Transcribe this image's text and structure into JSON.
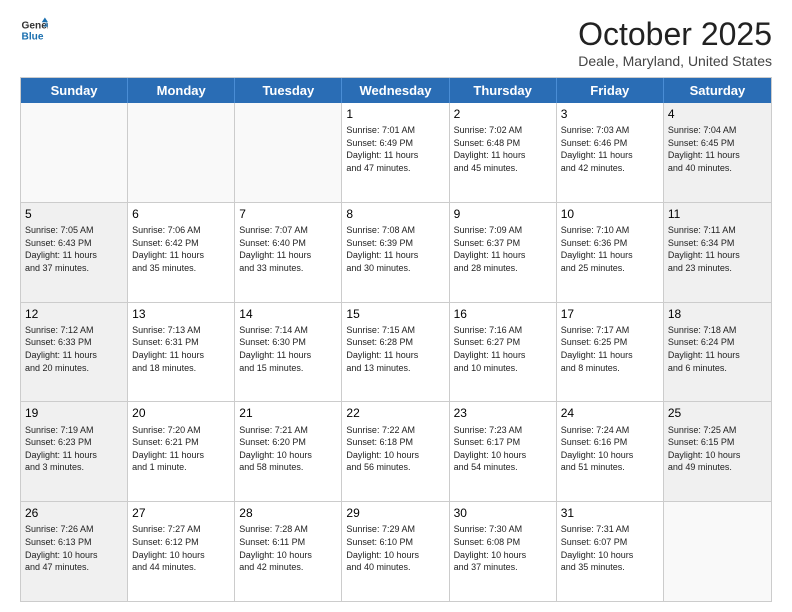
{
  "logo": {
    "line1": "General",
    "line2": "Blue"
  },
  "title": "October 2025",
  "subtitle": "Deale, Maryland, United States",
  "weekdays": [
    "Sunday",
    "Monday",
    "Tuesday",
    "Wednesday",
    "Thursday",
    "Friday",
    "Saturday"
  ],
  "weeks": [
    [
      {
        "day": "",
        "text": "",
        "empty": true
      },
      {
        "day": "",
        "text": "",
        "empty": true
      },
      {
        "day": "",
        "text": "",
        "empty": true
      },
      {
        "day": "1",
        "text": "Sunrise: 7:01 AM\nSunset: 6:49 PM\nDaylight: 11 hours\nand 47 minutes."
      },
      {
        "day": "2",
        "text": "Sunrise: 7:02 AM\nSunset: 6:48 PM\nDaylight: 11 hours\nand 45 minutes."
      },
      {
        "day": "3",
        "text": "Sunrise: 7:03 AM\nSunset: 6:46 PM\nDaylight: 11 hours\nand 42 minutes."
      },
      {
        "day": "4",
        "text": "Sunrise: 7:04 AM\nSunset: 6:45 PM\nDaylight: 11 hours\nand 40 minutes."
      }
    ],
    [
      {
        "day": "5",
        "text": "Sunrise: 7:05 AM\nSunset: 6:43 PM\nDaylight: 11 hours\nand 37 minutes."
      },
      {
        "day": "6",
        "text": "Sunrise: 7:06 AM\nSunset: 6:42 PM\nDaylight: 11 hours\nand 35 minutes."
      },
      {
        "day": "7",
        "text": "Sunrise: 7:07 AM\nSunset: 6:40 PM\nDaylight: 11 hours\nand 33 minutes."
      },
      {
        "day": "8",
        "text": "Sunrise: 7:08 AM\nSunset: 6:39 PM\nDaylight: 11 hours\nand 30 minutes."
      },
      {
        "day": "9",
        "text": "Sunrise: 7:09 AM\nSunset: 6:37 PM\nDaylight: 11 hours\nand 28 minutes."
      },
      {
        "day": "10",
        "text": "Sunrise: 7:10 AM\nSunset: 6:36 PM\nDaylight: 11 hours\nand 25 minutes."
      },
      {
        "day": "11",
        "text": "Sunrise: 7:11 AM\nSunset: 6:34 PM\nDaylight: 11 hours\nand 23 minutes."
      }
    ],
    [
      {
        "day": "12",
        "text": "Sunrise: 7:12 AM\nSunset: 6:33 PM\nDaylight: 11 hours\nand 20 minutes."
      },
      {
        "day": "13",
        "text": "Sunrise: 7:13 AM\nSunset: 6:31 PM\nDaylight: 11 hours\nand 18 minutes."
      },
      {
        "day": "14",
        "text": "Sunrise: 7:14 AM\nSunset: 6:30 PM\nDaylight: 11 hours\nand 15 minutes."
      },
      {
        "day": "15",
        "text": "Sunrise: 7:15 AM\nSunset: 6:28 PM\nDaylight: 11 hours\nand 13 minutes."
      },
      {
        "day": "16",
        "text": "Sunrise: 7:16 AM\nSunset: 6:27 PM\nDaylight: 11 hours\nand 10 minutes."
      },
      {
        "day": "17",
        "text": "Sunrise: 7:17 AM\nSunset: 6:25 PM\nDaylight: 11 hours\nand 8 minutes."
      },
      {
        "day": "18",
        "text": "Sunrise: 7:18 AM\nSunset: 6:24 PM\nDaylight: 11 hours\nand 6 minutes."
      }
    ],
    [
      {
        "day": "19",
        "text": "Sunrise: 7:19 AM\nSunset: 6:23 PM\nDaylight: 11 hours\nand 3 minutes."
      },
      {
        "day": "20",
        "text": "Sunrise: 7:20 AM\nSunset: 6:21 PM\nDaylight: 11 hours\nand 1 minute."
      },
      {
        "day": "21",
        "text": "Sunrise: 7:21 AM\nSunset: 6:20 PM\nDaylight: 10 hours\nand 58 minutes."
      },
      {
        "day": "22",
        "text": "Sunrise: 7:22 AM\nSunset: 6:18 PM\nDaylight: 10 hours\nand 56 minutes."
      },
      {
        "day": "23",
        "text": "Sunrise: 7:23 AM\nSunset: 6:17 PM\nDaylight: 10 hours\nand 54 minutes."
      },
      {
        "day": "24",
        "text": "Sunrise: 7:24 AM\nSunset: 6:16 PM\nDaylight: 10 hours\nand 51 minutes."
      },
      {
        "day": "25",
        "text": "Sunrise: 7:25 AM\nSunset: 6:15 PM\nDaylight: 10 hours\nand 49 minutes."
      }
    ],
    [
      {
        "day": "26",
        "text": "Sunrise: 7:26 AM\nSunset: 6:13 PM\nDaylight: 10 hours\nand 47 minutes."
      },
      {
        "day": "27",
        "text": "Sunrise: 7:27 AM\nSunset: 6:12 PM\nDaylight: 10 hours\nand 44 minutes."
      },
      {
        "day": "28",
        "text": "Sunrise: 7:28 AM\nSunset: 6:11 PM\nDaylight: 10 hours\nand 42 minutes."
      },
      {
        "day": "29",
        "text": "Sunrise: 7:29 AM\nSunset: 6:10 PM\nDaylight: 10 hours\nand 40 minutes."
      },
      {
        "day": "30",
        "text": "Sunrise: 7:30 AM\nSunset: 6:08 PM\nDaylight: 10 hours\nand 37 minutes."
      },
      {
        "day": "31",
        "text": "Sunrise: 7:31 AM\nSunset: 6:07 PM\nDaylight: 10 hours\nand 35 minutes."
      },
      {
        "day": "",
        "text": "",
        "empty": true
      }
    ]
  ]
}
